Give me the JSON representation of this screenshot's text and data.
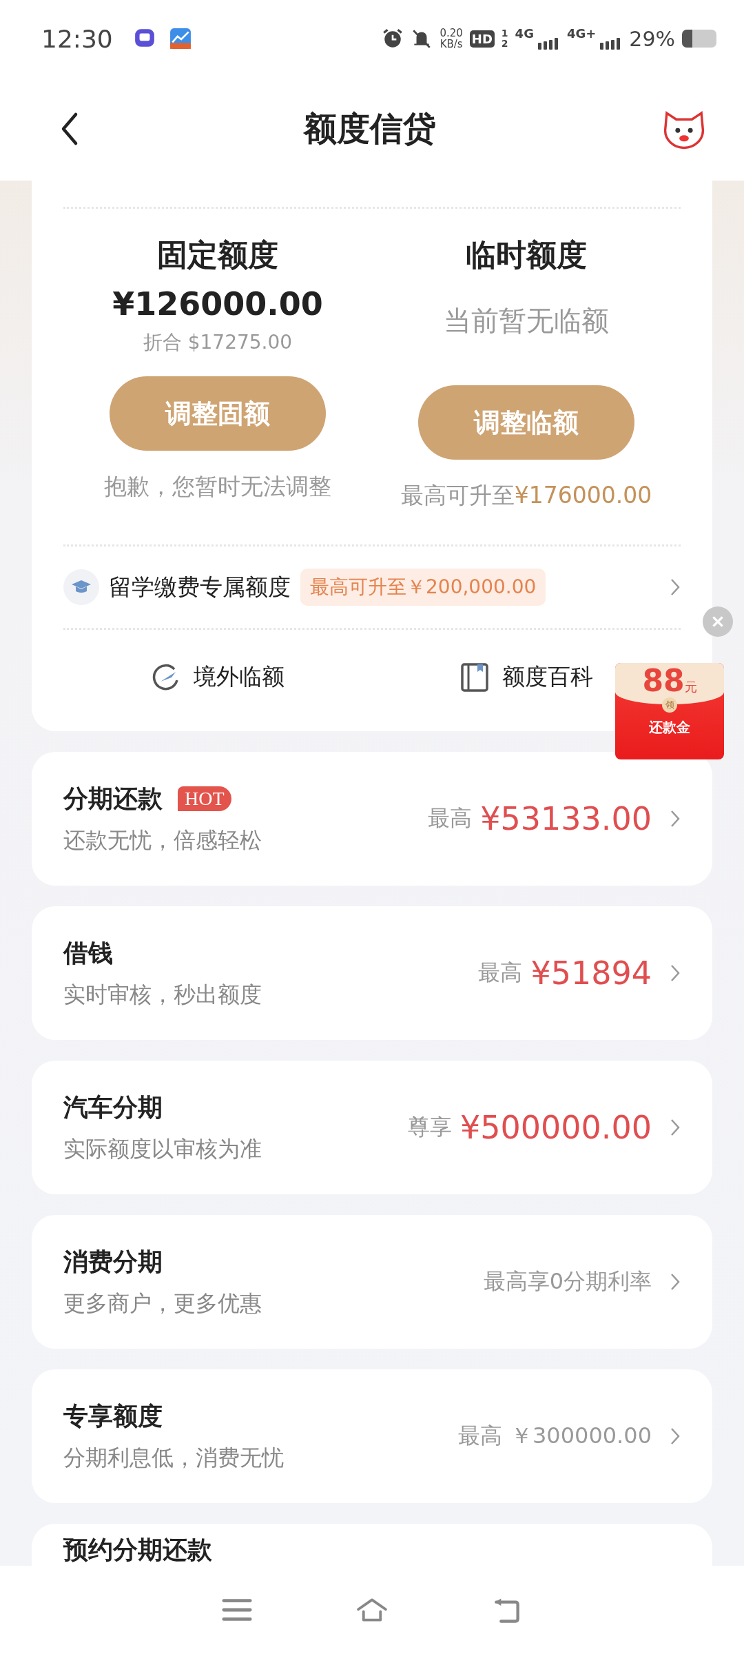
{
  "status_bar": {
    "time": "12:30",
    "speed_value": "0.20",
    "speed_unit": "KB/s",
    "hd": "HD",
    "hd_sup": "1",
    "hd_sub": "2",
    "net_primary": "4G",
    "net_secondary": "4G+",
    "battery": "29%"
  },
  "header": {
    "title": "额度信贷"
  },
  "quota": {
    "columns": [
      {
        "kind": "amount",
        "title": "固定额度",
        "amount": "¥126000.00",
        "converted": "折合 $17275.00",
        "button": "调整固额",
        "note": "抱歉，您暂时无法调整"
      },
      {
        "kind": "status",
        "title": "临时额度",
        "status": "当前暂无临额",
        "button": "调整临额",
        "note": "最高可升至",
        "note_highlight": "¥176000.00"
      }
    ],
    "study": {
      "label": "留学缴费专属额度",
      "badge": "最高可升至￥200,000.00"
    },
    "shortcuts": [
      {
        "label": "境外临额"
      },
      {
        "label": "额度百科"
      }
    ]
  },
  "promo": {
    "amount": "88",
    "unit": "元",
    "seal": "领",
    "label": "还款金"
  },
  "products": [
    {
      "title": "分期还款",
      "tag": "HOT",
      "subtitle": "还款无忧，倍感轻松",
      "prefix": "最高",
      "value": "¥53133.00",
      "emphasis": true
    },
    {
      "title": "借钱",
      "subtitle": "实时审核，秒出额度",
      "prefix": "最高",
      "value": "¥51894",
      "emphasis": true
    },
    {
      "title": "汽车分期",
      "subtitle": "实际额度以审核为准",
      "prefix": "尊享",
      "value": "¥500000.00",
      "emphasis": true
    },
    {
      "title": "消费分期",
      "subtitle": "更多商户，更多优惠",
      "value": "最高享0分期利率",
      "emphasis": false
    },
    {
      "title": "专享额度",
      "subtitle": "分期利息低，消费无忧",
      "prefix": "最高",
      "value": "￥300000.00",
      "emphasis": false
    },
    {
      "title": "预约分期还款"
    }
  ]
}
